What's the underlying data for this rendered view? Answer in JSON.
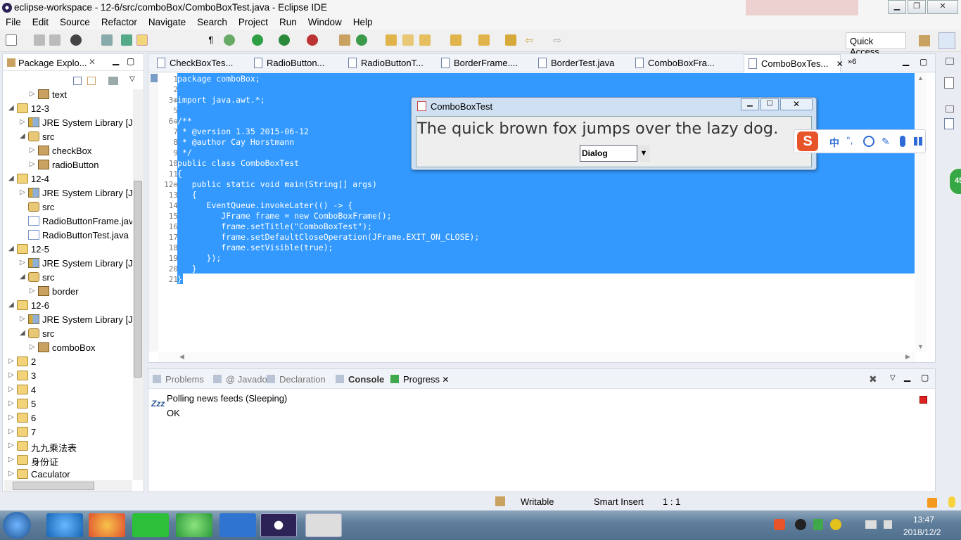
{
  "window": {
    "title": "eclipse-workspace - 12-6/src/comboBox/ComboBoxTest.java - Eclipse IDE"
  },
  "menu": [
    "File",
    "Edit",
    "Source",
    "Refactor",
    "Navigate",
    "Search",
    "Project",
    "Run",
    "Window",
    "Help"
  ],
  "quick_access": "Quick Access",
  "package_explorer": {
    "title": "Package Explo...",
    "rows": [
      {
        "label": "text",
        "icon": "pkg",
        "indent": 3,
        "arrow": "▷"
      },
      {
        "label": "12-3",
        "icon": "proj",
        "indent": 0,
        "arrow": "◢"
      },
      {
        "label": "JRE System Library [Ja",
        "icon": "lib",
        "indent": 1,
        "arrow": "▷"
      },
      {
        "label": "src",
        "icon": "src",
        "indent": 1,
        "arrow": "◢"
      },
      {
        "label": "checkBox",
        "icon": "pkg",
        "indent": 2,
        "arrow": "▷"
      },
      {
        "label": "radioButton",
        "icon": "pkg",
        "indent": 2,
        "arrow": "▷"
      },
      {
        "label": "12-4",
        "icon": "proj",
        "indent": 0,
        "arrow": "◢"
      },
      {
        "label": "JRE System Library [Ja",
        "icon": "lib",
        "indent": 1,
        "arrow": "▷"
      },
      {
        "label": "src",
        "icon": "src",
        "indent": 1,
        "arrow": ""
      },
      {
        "label": "RadioButtonFrame.jav",
        "icon": "java",
        "indent": 1,
        "arrow": ""
      },
      {
        "label": "RadioButtonTest.java",
        "icon": "java",
        "indent": 1,
        "arrow": ""
      },
      {
        "label": "12-5",
        "icon": "proj",
        "indent": 0,
        "arrow": "◢"
      },
      {
        "label": "JRE System Library [Ja",
        "icon": "lib",
        "indent": 1,
        "arrow": "▷"
      },
      {
        "label": "src",
        "icon": "src",
        "indent": 1,
        "arrow": "◢"
      },
      {
        "label": "border",
        "icon": "pkg",
        "indent": 2,
        "arrow": "▷"
      },
      {
        "label": "12-6",
        "icon": "proj",
        "indent": 0,
        "arrow": "◢"
      },
      {
        "label": "JRE System Library [Ja",
        "icon": "lib",
        "indent": 1,
        "arrow": "▷"
      },
      {
        "label": "src",
        "icon": "src",
        "indent": 1,
        "arrow": "◢"
      },
      {
        "label": "comboBox",
        "icon": "pkg",
        "indent": 2,
        "arrow": "▷"
      },
      {
        "label": "2",
        "icon": "proj",
        "indent": 0,
        "arrow": "▷"
      },
      {
        "label": "3",
        "icon": "proj",
        "indent": 0,
        "arrow": "▷"
      },
      {
        "label": "4",
        "icon": "proj",
        "indent": 0,
        "arrow": "▷"
      },
      {
        "label": "5",
        "icon": "proj",
        "indent": 0,
        "arrow": "▷"
      },
      {
        "label": "6",
        "icon": "proj",
        "indent": 0,
        "arrow": "▷"
      },
      {
        "label": "7",
        "icon": "proj",
        "indent": 0,
        "arrow": "▷"
      },
      {
        "label": "九九乘法表",
        "icon": "proj",
        "indent": 0,
        "arrow": "▷"
      },
      {
        "label": "身份证",
        "icon": "proj",
        "indent": 0,
        "arrow": "▷"
      },
      {
        "label": "Caculator",
        "icon": "proj",
        "indent": 0,
        "arrow": "▷"
      }
    ]
  },
  "editor_tabs": [
    {
      "label": "CheckBoxTes...",
      "active": false
    },
    {
      "label": "RadioButton...",
      "active": false
    },
    {
      "label": "RadioButtonT...",
      "active": false
    },
    {
      "label": "BorderFrame....",
      "active": false
    },
    {
      "label": "BorderTest.java",
      "active": false
    },
    {
      "label": "ComboBoxFra...",
      "active": false
    },
    {
      "label": "ComboBoxTes...",
      "active": true
    }
  ],
  "tab_overflow": "»6",
  "code_lines": [
    {
      "n": "1",
      "text": "package comboBox;"
    },
    {
      "n": "2",
      "text": ""
    },
    {
      "n": "3⊕",
      "text": "import java.awt.*;"
    },
    {
      "n": "5",
      "text": ""
    },
    {
      "n": "6⊖",
      "text": "/**"
    },
    {
      "n": "7",
      "text": " * @version 1.35 2015-06-12"
    },
    {
      "n": "8",
      "text": " * @author Cay Horstmann"
    },
    {
      "n": "9",
      "text": " */"
    },
    {
      "n": "10",
      "text": "public class ComboBoxTest"
    },
    {
      "n": "11",
      "text": "{"
    },
    {
      "n": "12⊖",
      "text": "   public static void main(String[] args)"
    },
    {
      "n": "13",
      "text": "   {"
    },
    {
      "n": "14",
      "text": "      EventQueue.invokeLater(() -> {"
    },
    {
      "n": "15",
      "text": "         JFrame frame = new ComboBoxFrame();"
    },
    {
      "n": "16",
      "text": "         frame.setTitle(\"ComboBoxTest\");"
    },
    {
      "n": "17",
      "text": "         frame.setDefaultCloseOperation(JFrame.EXIT_ON_CLOSE);"
    },
    {
      "n": "18",
      "text": "         frame.setVisible(true);"
    },
    {
      "n": "19",
      "text": "      });"
    },
    {
      "n": "20",
      "text": "   }"
    },
    {
      "n": "21",
      "text": "}"
    }
  ],
  "bottom_tabs": [
    {
      "label": "Problems",
      "active": false
    },
    {
      "label": "@ Javadoc",
      "active": false
    },
    {
      "label": "Declaration",
      "active": false
    },
    {
      "label": "Console",
      "active": false
    },
    {
      "label": "Progress",
      "active": true
    }
  ],
  "progress": {
    "job": "Polling news feeds (Sleeping)",
    "status": "OK",
    "zzz": "Zzz"
  },
  "statusbar": {
    "writable": "Writable",
    "insert": "Smart Insert",
    "position": "1 : 1"
  },
  "dialog": {
    "title": "ComboBoxTest",
    "sample_text": "The quick brown fox jumps over the lazy dog.",
    "combo_value": "Dialog"
  },
  "ime": {
    "label": "中"
  },
  "clock": {
    "time": "13:47",
    "date": "2018/12/2"
  },
  "badge": "45",
  "colors": {
    "selection": "#3399ff",
    "accent": "#2f5a94"
  }
}
